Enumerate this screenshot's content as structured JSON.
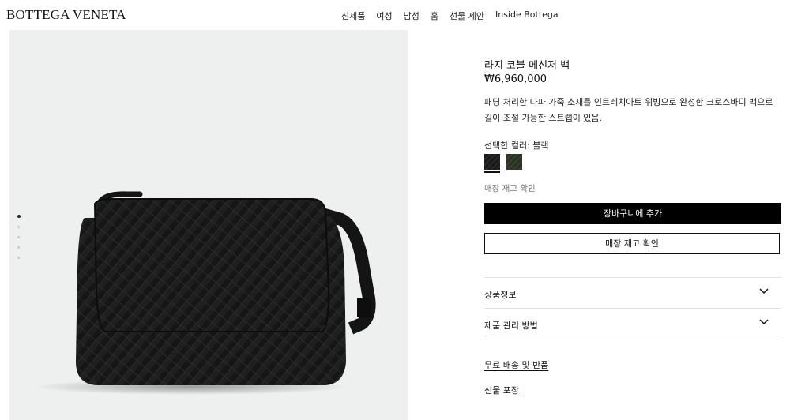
{
  "header": {
    "logo": "BOTTEGA VENETA",
    "nav": [
      "신제품",
      "여성",
      "남성",
      "홈",
      "선물 제안",
      "Inside Bottega"
    ]
  },
  "product": {
    "title": "라지 코블 메신저 백",
    "price": "₩6,960,000",
    "description": "패딩 처리한 나파 가죽 소재를 인트레치아토 위빙으로 완성한 크로스바디 백으로 길이 조절 가능한 스트랩이 있음.",
    "color_label": "선택한 컬러: 블랙",
    "swatches": [
      {
        "name": "black",
        "color": "#1a1a1a"
      },
      {
        "name": "dark-green",
        "color": "#2b3326"
      }
    ],
    "store_stock_small": "매장 재고 확인",
    "add_to_cart": "장바구니에 추가",
    "check_store_stock": "매장 재고 확인",
    "accordion": [
      "상품정보",
      "제품 관리 방법"
    ],
    "links": [
      "무료 배송 및 반품",
      "선물 포장"
    ]
  },
  "gallery": {
    "image_icon": "woven-leather-bag-image",
    "dots_total": 5,
    "dots_active": 1
  }
}
